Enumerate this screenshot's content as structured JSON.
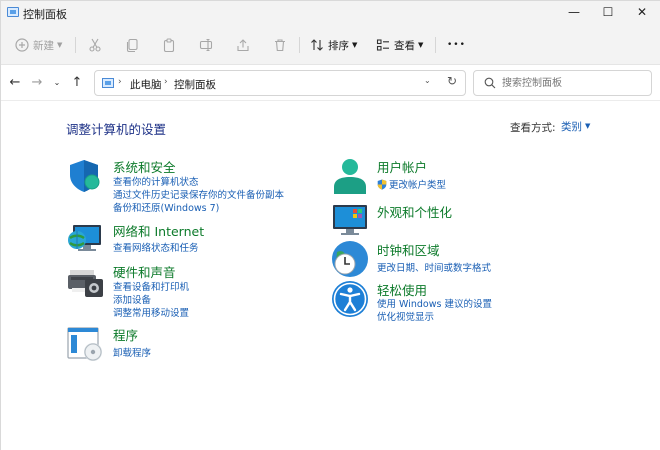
{
  "window": {
    "title": "控制面板",
    "controls": {
      "minimize": "—",
      "maximize": "☐",
      "close": "✕"
    }
  },
  "toolbar": {
    "new_label": "新建",
    "sort_label": "排序",
    "view_label": "查看",
    "more_label": "•••"
  },
  "address": {
    "crumbs": [
      "此电脑",
      "控制面板"
    ],
    "search_placeholder": "搜索控制面板"
  },
  "main": {
    "heading": "调整计算机的设置",
    "view_by_label": "查看方式:",
    "view_by_value": "类别"
  },
  "categories": {
    "system": {
      "title": "系统和安全",
      "links": [
        "查看你的计算机状态",
        "通过文件历史记录保存你的文件备份副本",
        "备份和还原(Windows 7)"
      ]
    },
    "network": {
      "title": "网络和 Internet",
      "links": [
        "查看网络状态和任务"
      ]
    },
    "hardware": {
      "title": "硬件和声音",
      "links": [
        "查看设备和打印机",
        "添加设备",
        "调整常用移动设置"
      ]
    },
    "programs": {
      "title": "程序",
      "links": [
        "卸载程序"
      ]
    },
    "users": {
      "title": "用户帐户",
      "links": [
        "更改帐户类型"
      ]
    },
    "appearance": {
      "title": "外观和个性化",
      "links": []
    },
    "clock": {
      "title": "时钟和区域",
      "links": [
        "更改日期、时间或数字格式"
      ]
    },
    "ease": {
      "title": "轻松使用",
      "links": [
        "使用 Windows 建议的设置",
        "优化视觉显示"
      ]
    }
  },
  "colors": {
    "category_title": "#0c7a2a",
    "link": "#1a5fb4",
    "heading": "#1e3287",
    "toolbar_bg": "#f3f3f3"
  }
}
